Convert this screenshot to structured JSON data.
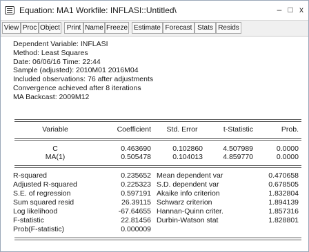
{
  "window": {
    "title": "Equation: MA1   Workfile: INFLASI::Untitled\\",
    "minimize_glyph": "–",
    "restore_glyph": "□",
    "close_glyph": "x"
  },
  "toolbar": [
    "View",
    "Proc",
    "Object",
    "Print",
    "Name",
    "Freeze",
    "Estimate",
    "Forecast",
    "Stats",
    "Resids"
  ],
  "header_info": [
    "Dependent Variable: INFLASI",
    "Method: Least Squares",
    "Date: 06/06/16   Time: 22:44",
    "Sample (adjusted): 2010M01 2016M04",
    "Included observations: 76 after adjustments",
    "Convergence achieved after 8 iterations",
    "MA Backcast: 2009M12"
  ],
  "table": {
    "columns": [
      "Variable",
      "Coefficient",
      "Std. Error",
      "t-Statistic",
      "Prob."
    ],
    "rows": [
      [
        "C",
        "0.463690",
        "0.102860",
        "4.507989",
        "0.0000"
      ],
      [
        "MA(1)",
        "0.505478",
        "0.104013",
        "4.859770",
        "0.0000"
      ]
    ]
  },
  "stats": {
    "left": [
      {
        "label": "R-squared",
        "value": "0.235652"
      },
      {
        "label": "Adjusted R-squared",
        "value": "0.225323"
      },
      {
        "label": "S.E. of regression",
        "value": "0.597191"
      },
      {
        "label": "Sum squared resid",
        "value": "26.39115"
      },
      {
        "label": "Log likelihood",
        "value": "-67.64655"
      },
      {
        "label": "F-statistic",
        "value": "22.81456"
      },
      {
        "label": "Prob(F-statistic)",
        "value": "0.000009"
      }
    ],
    "right": [
      {
        "label": "Mean dependent var",
        "value": "0.470658"
      },
      {
        "label": "S.D. dependent var",
        "value": "0.678505"
      },
      {
        "label": "Akaike info criterion",
        "value": "1.832804"
      },
      {
        "label": "Schwarz criterion",
        "value": "1.894139"
      },
      {
        "label": "Hannan-Quinn criter.",
        "value": "1.857316"
      },
      {
        "label": "Durbin-Watson stat",
        "value": "1.828801"
      }
    ]
  }
}
